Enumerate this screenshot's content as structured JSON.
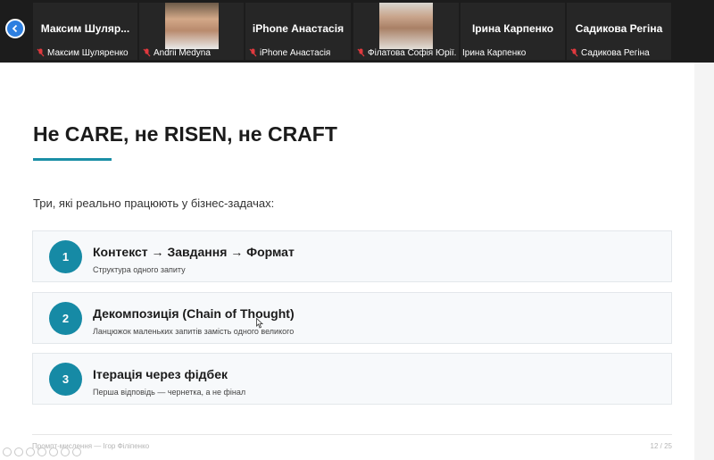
{
  "participants": [
    {
      "display_name": "Максим Шуляр...",
      "caption": "Максим Шуляренко",
      "muted": true,
      "has_video": false
    },
    {
      "display_name": "",
      "caption": "Andrii Medyna",
      "muted": true,
      "has_video": true
    },
    {
      "display_name": "iPhone Анастасія",
      "caption": "iPhone Анастасія",
      "muted": true,
      "has_video": false
    },
    {
      "display_name": "",
      "caption": "Філатова Софія Юрії...",
      "muted": true,
      "has_video": true
    },
    {
      "display_name": "Ірина Карпенко",
      "caption": "Ірина Карпенко",
      "muted": false,
      "has_video": false
    },
    {
      "display_name": "Садикова Регіна",
      "caption": "Садикова Регіна",
      "muted": true,
      "has_video": false
    }
  ],
  "slide": {
    "title": "Не CARE, не RISEN, не CRAFT",
    "intro": "Три, які реально працюють у бізнес-задачах:",
    "items": [
      {
        "number": "1",
        "title": "Контекст → Завдання → Формат",
        "subtitle": "Структура одного запиту"
      },
      {
        "number": "2",
        "title": "Декомпозиція (Chain of Thought)",
        "subtitle": "Ланцюжок маленьких запитів замість одного великого"
      },
      {
        "number": "3",
        "title": "Ітерація через фідбек",
        "subtitle": "Перша відповідь — чернетка, а не фінал"
      }
    ],
    "footer_left": "Промпт-мислення — Ігор Філіпенко",
    "footer_right": "12 / 25"
  },
  "colors": {
    "accent": "#168aa5",
    "strip_bg": "#1c1c1c",
    "back_button": "#2d7fe0",
    "mic_off": "#e0393e"
  }
}
